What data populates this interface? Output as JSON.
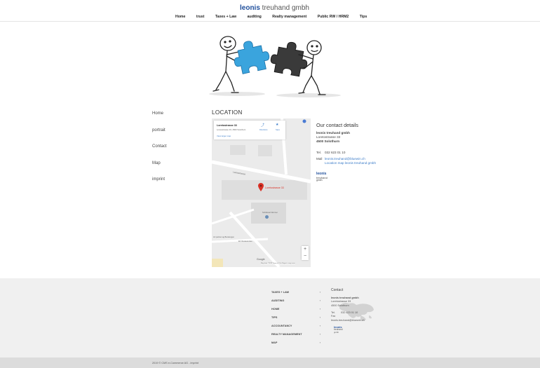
{
  "header": {
    "brand_bold": "leonis",
    "brand_rest": " treuhand gmbh",
    "nav": [
      "Home",
      "trust",
      "Taxes + Law",
      "auditing",
      "Realty management",
      "Public RW / HRM2",
      "Tips"
    ]
  },
  "sidenav": [
    "Home",
    "portrait",
    "Contact",
    "Map",
    "imprint"
  ],
  "main": {
    "heading": "LOCATION",
    "map": {
      "place_name": "Loretostrasse 33",
      "place_address": "Loretostrasse 33, 4500 Solothurn",
      "directions_label": "Directions",
      "save_label": "Save",
      "larger_map_link": "View larger map",
      "street_label": "Loretostrasse",
      "marker_label": "Loretostrasse 33",
      "poi_1": "Schlüssel Werner",
      "poi_2": "Art partner ag Beratungen",
      "poi_3": "Ell. Restaurenten",
      "zoom_in": "+",
      "zoom_out": "−",
      "google_label": "Google",
      "footer_text": "Map data ©2019   Terms of Use   Report a map error"
    },
    "contact": {
      "title": "Our contact details",
      "company": "leonis treuhand gmbh",
      "street": "Loretostrasse 33",
      "city": "4500 Solothurn",
      "tel_label": "Tel.",
      "tel_value": "032 623 01 10",
      "mail_label": "Mail",
      "mail_value": "leonis.treuhand@bluewin.ch",
      "map_link": "Location map leonis treuhand gmbh",
      "logo_brand": "leonis",
      "logo_line2": "treuhand",
      "logo_line3": "gmbh"
    }
  },
  "footer": {
    "links": [
      "TAXES + LAW",
      "AUDITING",
      "HOME",
      "TIPS",
      "ACCOUNTANCY",
      "REALTY MANAGEMENT",
      "MAP"
    ],
    "chevron": "›",
    "contact_title": "Contact",
    "company": "leonis treuhand gmbh",
    "street": "Loretostrasse 33",
    "city": "4500 Solothurn",
    "tel_label": "Tel.",
    "tel_value": "032 623 01 10",
    "fax_label": "Fax",
    "email": "leonis.treuhand@bluewin.ch",
    "logo_brand": "leonis",
    "logo_line2": "treuhand",
    "logo_line3": "gmbh",
    "copyright": "2019 © CMS e-Commerce AG",
    "separator": " - ",
    "imprint": "imprint"
  },
  "colors": {
    "brand": "#1f4f9c",
    "puzzle_blue": "#3aa4dd",
    "puzzle_dark": "#333333",
    "marker": "#d93025",
    "link": "#3a7bc8"
  }
}
